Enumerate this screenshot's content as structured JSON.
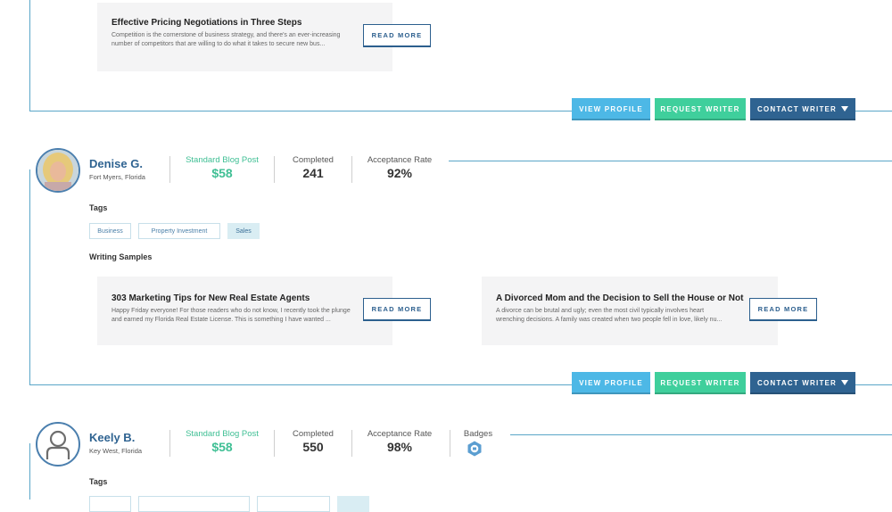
{
  "top_card": {
    "sample": {
      "title": "Effective Pricing Negotiations in Three Steps",
      "excerpt": "Competition is the cornerstone of business strategy, and there's an ever-increasing number of competitors that are willing to do what it takes to secure new bus...",
      "read_more": "READ MORE"
    },
    "actions": {
      "view_profile": "VIEW PROFILE",
      "request_writer": "REQUEST WRITER",
      "contact_writer": "CONTACT WRITER"
    }
  },
  "writers": [
    {
      "name": "Denise G.",
      "location": "Fort Myers, Florida",
      "price_label": "Standard Blog Post",
      "price": "$58",
      "completed_label": "Completed",
      "completed": "241",
      "acceptance_label": "Acceptance Rate",
      "acceptance": "92%",
      "tags_label": "Tags",
      "tags": [
        "Business",
        "Property Investment",
        "Sales"
      ],
      "samples_label": "Writing Samples",
      "samples": [
        {
          "title": "303 Marketing Tips for New Real Estate Agents",
          "excerpt": "Happy Friday everyone! For those readers who do not know, I recently took the plunge and earned my Florida Real Estate License. This is something I have wanted ...",
          "read_more": "READ MORE"
        },
        {
          "title": "A Divorced Mom and the Decision to Sell the House or Not",
          "excerpt": "A divorce can be brutal and ugly; even the most civil typically involves heart wrenching decisions. A family was created when two people fell in love, likely nu...",
          "read_more": "READ MORE"
        }
      ],
      "actions": {
        "view_profile": "VIEW PROFILE",
        "request_writer": "REQUEST WRITER",
        "contact_writer": "CONTACT WRITER"
      }
    },
    {
      "name": "Keely B.",
      "location": "Key West, Florida",
      "price_label": "Standard Blog Post",
      "price": "$58",
      "completed_label": "Completed",
      "completed": "550",
      "acceptance_label": "Acceptance Rate",
      "acceptance": "98%",
      "badges_label": "Badges",
      "tags_label": "Tags"
    }
  ],
  "colors": {
    "accent_blue": "#2f6391",
    "view_profile": "#4db8e6",
    "request_writer": "#3fcf9c",
    "price_green": "#3fbf94",
    "line": "#5aa6c8"
  }
}
